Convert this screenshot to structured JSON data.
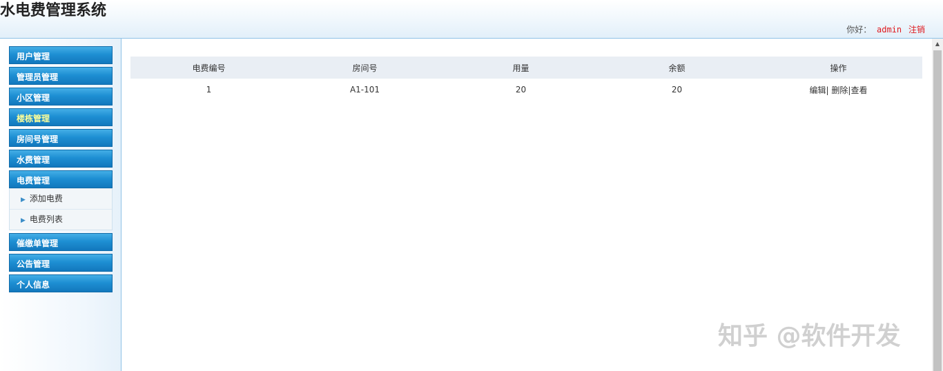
{
  "header": {
    "title": "水电费管理系统",
    "greeting": "你好：",
    "username": "admin",
    "logout": "注销"
  },
  "sidebar": {
    "menus": [
      {
        "label": "用户管理"
      },
      {
        "label": "管理员管理"
      },
      {
        "label": "小区管理"
      },
      {
        "label": "楼栋管理"
      },
      {
        "label": "房间号管理"
      },
      {
        "label": "水费管理"
      },
      {
        "label": "电费管理",
        "items": [
          "添加电费",
          "电费列表"
        ]
      },
      {
        "label": "催缴单管理"
      },
      {
        "label": "公告管理"
      },
      {
        "label": "个人信息"
      }
    ]
  },
  "table": {
    "headers": [
      "电费编号",
      "房间号",
      "用量",
      "余额",
      "操作"
    ],
    "rows": [
      {
        "id": "1",
        "room": "A1-101",
        "usage": "20",
        "balance": "20",
        "actions": {
          "edit": "编辑",
          "sep1": "| ",
          "delete": "删除",
          "sep2": "|",
          "view": "查看"
        }
      }
    ]
  },
  "watermark": "知乎 @软件开发",
  "colors": {
    "menu_header": "#1e8fd3",
    "accent_red": "#e0191e",
    "highlight_yellow": "#ffff99"
  }
}
